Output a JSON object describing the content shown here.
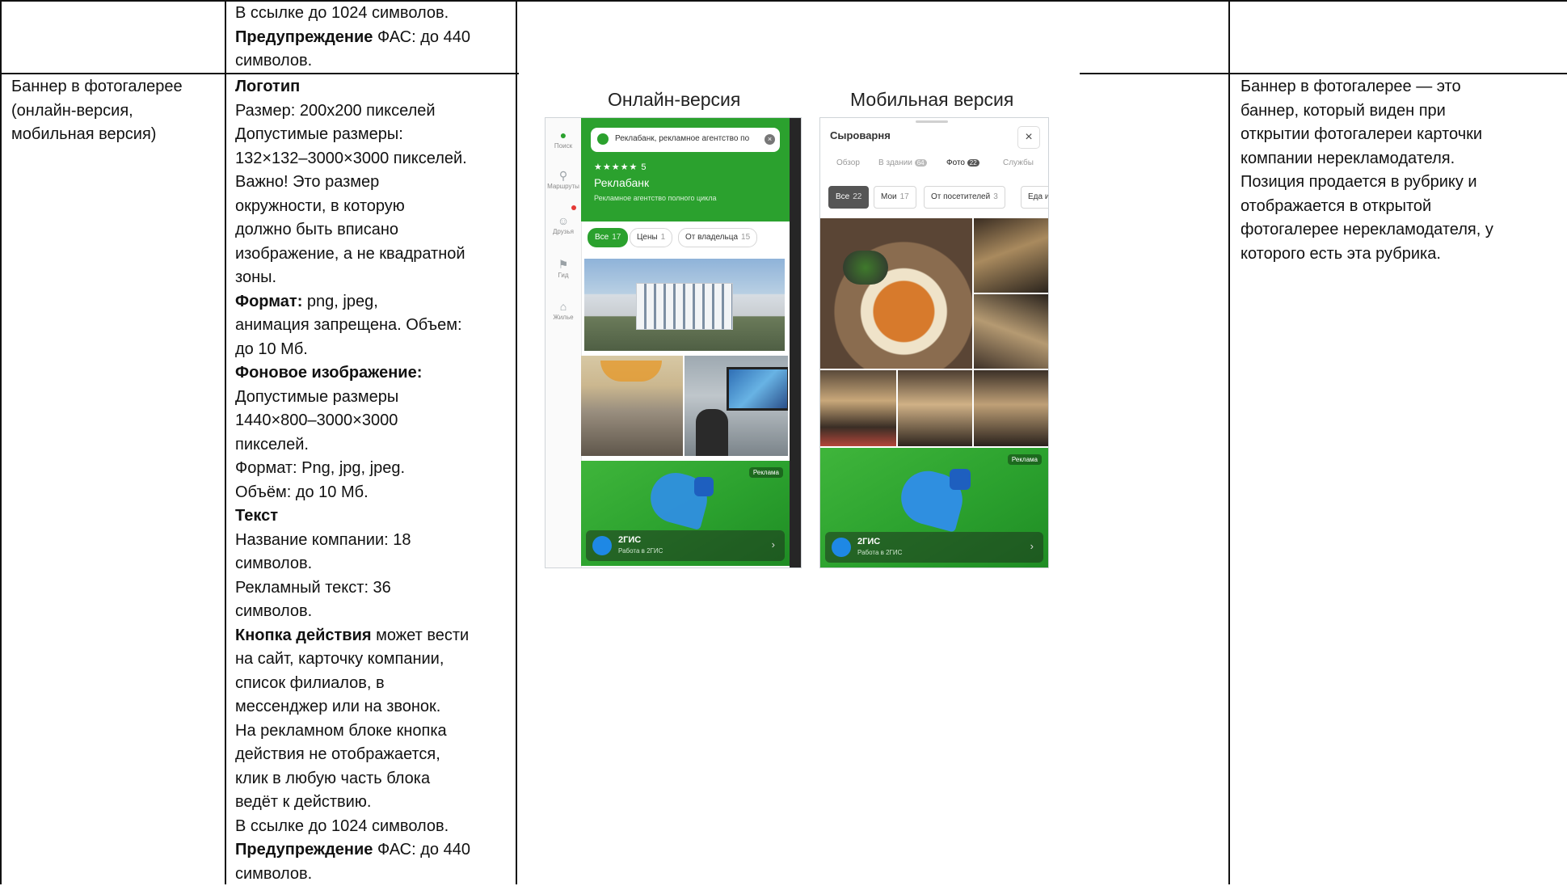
{
  "top_row": {
    "col2_lines": [
      {
        "text": "В ссылке до 1024 символов."
      },
      {
        "bold": "Предупреждение",
        "text": " ФАС: до 440"
      },
      {
        "text": "символов."
      }
    ]
  },
  "row": {
    "col1_lines": [
      "Баннер в фотогалерее",
      "(онлайн-версия,",
      "мобильная версия)"
    ],
    "col2_lines": [
      {
        "bold": "Логотип"
      },
      {
        "text": "Размер: 200x200 пикселей"
      },
      {
        "text": "Допустимые размеры:"
      },
      {
        "text": "132×132–3000×3000 пикселей."
      },
      {
        "text": "Важно! Это размер"
      },
      {
        "text": "окружности, в которую"
      },
      {
        "text": "должно быть вписано"
      },
      {
        "text": "изображение, а не квадратной"
      },
      {
        "text": "зоны."
      },
      {
        "bold": "Формат:",
        "text": " png, jpeg,"
      },
      {
        "text": "анимация запрещена. Объем:"
      },
      {
        "text": "до 10 Мб."
      },
      {
        "bold": "Фоновое изображение:"
      },
      {
        "text": "Допустимые размеры"
      },
      {
        "text": "1440×800–3000×3000"
      },
      {
        "text": "пикселей."
      },
      {
        "text": "Формат: Png, jpg, jpeg."
      },
      {
        "text": "Объём: до 10 Мб."
      },
      {
        "bold": "Текст"
      },
      {
        "text": "Название компании: 18"
      },
      {
        "text": "символов."
      },
      {
        "text": "Рекламный текст: 36"
      },
      {
        "text": "символов."
      },
      {
        "bold": "Кнопка действия",
        "text": " может вести"
      },
      {
        "text": "на сайт, карточку компании,"
      },
      {
        "text": "список филиалов, в"
      },
      {
        "text": "мессенджер или на звонок."
      },
      {
        "text": "На рекламном блоке кнопка"
      },
      {
        "text": "действия не отображается,"
      },
      {
        "text": "клик в любую часть блока"
      },
      {
        "text": "ведёт к действию."
      },
      {
        "text": "В ссылке до 1024 символов."
      },
      {
        "bold": "Предупреждение",
        "text": " ФАС: до 440"
      },
      {
        "text": "символов."
      }
    ],
    "col4_lines": [
      "Баннер в фотогалерее — это",
      "баннер, который виден при",
      "открытии фотогалереи карточки",
      "компании нерекламодателя.",
      "Позиция продается в рубрику и",
      "отображается в открытой",
      "фотогалерее нерекламодателя, у",
      "которого есть эта рубрика."
    ]
  },
  "illustration": {
    "online_title": "Онлайн-версия",
    "mobile_title": "Мобильная версия",
    "online": {
      "sidebar": [
        {
          "icon": "pin",
          "label": "Поиск"
        },
        {
          "icon": "route",
          "label": "Маршруты"
        },
        {
          "icon": "friends",
          "label": "Друзья"
        },
        {
          "icon": "flag",
          "label": "Гид"
        },
        {
          "icon": "home",
          "label": "Жилье"
        }
      ],
      "search_text": "Реклабанк, рекламное агентство по",
      "stars": "★★★★★ 5",
      "company": "Реклабанк",
      "subtitle": "Рекламное агентство полного цикла",
      "chips": [
        {
          "label": "Все",
          "count": "17",
          "active": true
        },
        {
          "label": "Цены",
          "count": "1",
          "active": false
        },
        {
          "label": "От владельца",
          "count": "15",
          "active": false
        }
      ],
      "ad_badge": "Реклама",
      "ad_name": "2ГИС",
      "ad_sub": "Работа в 2ГИС"
    },
    "mobile": {
      "title": "Сыроварня",
      "tabs": [
        {
          "label": "Обзор",
          "count": ""
        },
        {
          "label": "В здании",
          "count": "64"
        },
        {
          "label": "Фото",
          "count": "22"
        },
        {
          "label": "Службы",
          "count": ""
        }
      ],
      "chips": [
        {
          "label": "Все",
          "count": "22",
          "active": true
        },
        {
          "label": "Мои",
          "count": "17",
          "active": false
        },
        {
          "label": "От посетителей",
          "count": "3",
          "active": false
        },
        {
          "label": "Еда и",
          "count": "",
          "active": false
        }
      ],
      "ad_badge": "Реклама",
      "ad_name": "2ГИС",
      "ad_sub": "Работа в 2ГИС"
    }
  }
}
